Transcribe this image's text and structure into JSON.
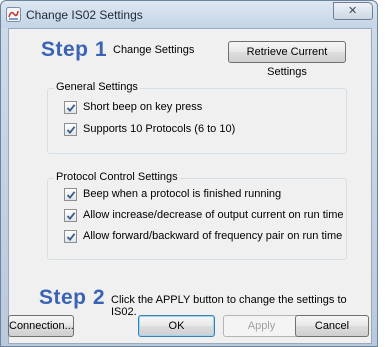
{
  "window": {
    "title": "Change IS02 Settings",
    "close_glyph": "✕"
  },
  "step1": {
    "number": "Step 1",
    "text": "Change Settings",
    "retrieve_button": "Retrieve Current Settings"
  },
  "general": {
    "title": "General Settings",
    "items": [
      {
        "label": "Short beep on key press",
        "checked": true
      },
      {
        "label": "Supports 10 Protocols (6 to 10)",
        "checked": true
      }
    ]
  },
  "protocol": {
    "title": "Protocol Control Settings",
    "items": [
      {
        "label": "Beep when a protocol is finished running",
        "checked": true
      },
      {
        "label": "Allow increase/decrease of output current on run time",
        "checked": true
      },
      {
        "label": "Allow forward/backward of frequency pair on run time",
        "checked": true
      }
    ]
  },
  "step2": {
    "number": "Step 2",
    "text": "Click the APPLY button to change the settings to IS02."
  },
  "buttons": {
    "connection": "Connection...",
    "ok": "OK",
    "apply": "Apply",
    "cancel": "Cancel"
  },
  "icons": {
    "app": "app-logo-icon",
    "check": "checkmark-icon",
    "close": "close-icon"
  }
}
